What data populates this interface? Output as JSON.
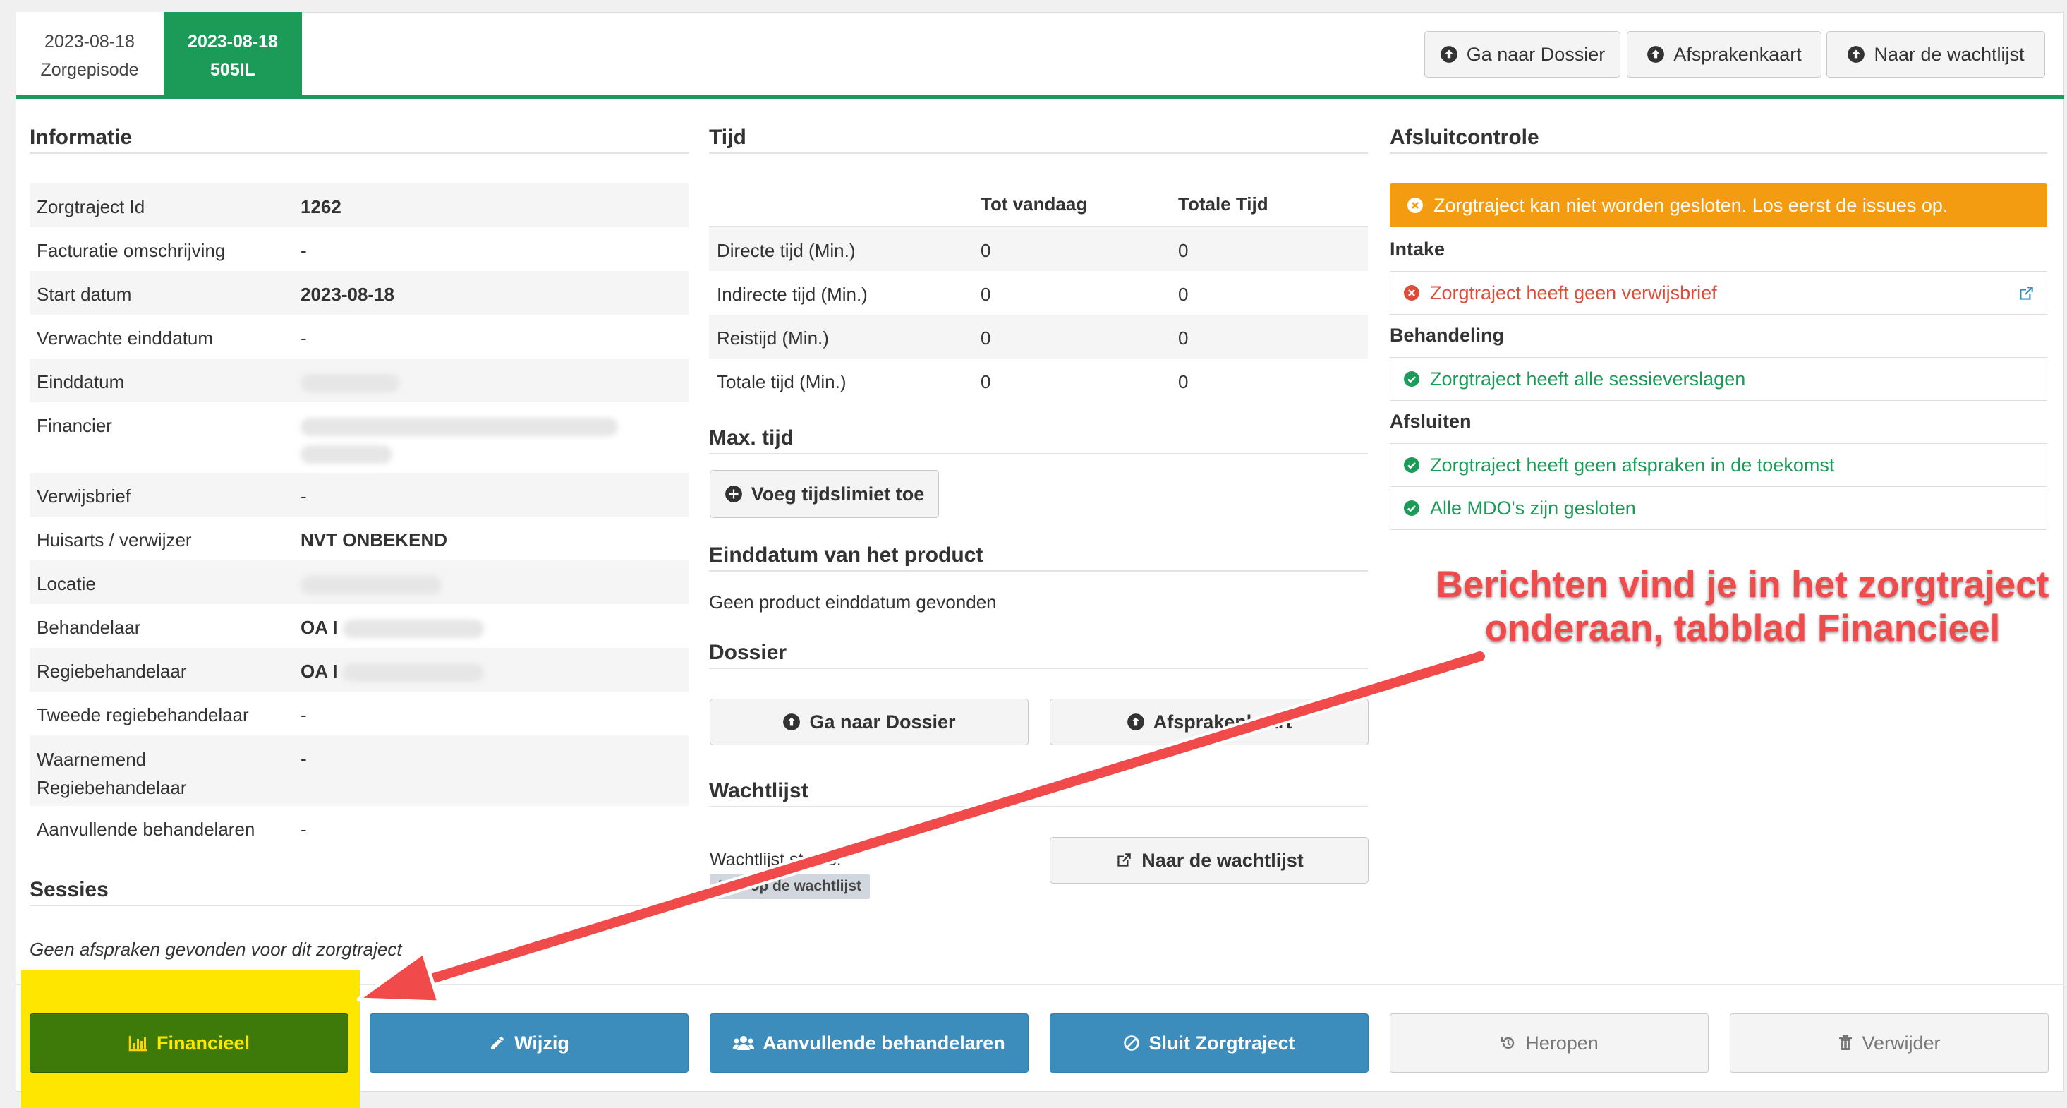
{
  "tabs": [
    {
      "date": "2023-08-18",
      "label": "Zorgepisode"
    },
    {
      "date": "2023-08-18",
      "label": "505IL"
    }
  ],
  "top_buttons": {
    "dossier": "Ga naar Dossier",
    "afsprakenkaart": "Afsprakenkaart",
    "wachtlijst": "Naar de wachtlijst"
  },
  "informatie": {
    "title": "Informatie",
    "rows": [
      {
        "label": "Zorgtraject Id",
        "value": "1262"
      },
      {
        "label": "Facturatie omschrijving",
        "value": "-"
      },
      {
        "label": "Start datum",
        "value": "2023-08-18"
      },
      {
        "label": "Verwachte einddatum",
        "value": "-"
      },
      {
        "label": "Einddatum",
        "value": ""
      },
      {
        "label": "Financier",
        "value": ""
      },
      {
        "label": "Verwijsbrief",
        "value": "-"
      },
      {
        "label": "Huisarts / verwijzer",
        "value": "NVT ONBEKEND"
      },
      {
        "label": "Locatie",
        "value": ""
      },
      {
        "label": "Behandelaar",
        "value": "OA I"
      },
      {
        "label": "Regiebehandelaar",
        "value": "OA I"
      },
      {
        "label": "Tweede regiebehandelaar",
        "value": "-"
      },
      {
        "label": "Waarnemend",
        "label2": "Regiebehandelaar",
        "value": "-"
      },
      {
        "label": "Aanvullende behandelaren",
        "value": "-"
      }
    ]
  },
  "sessies": {
    "title": "Sessies",
    "empty": "Geen afspraken gevonden voor dit zorgtraject"
  },
  "tijd": {
    "title": "Tijd",
    "col_today": "Tot vandaag",
    "col_total": "Totale Tijd",
    "rows": [
      {
        "label": "Directe tijd (Min.)",
        "today": "0",
        "total": "0"
      },
      {
        "label": "Indirecte tijd (Min.)",
        "today": "0",
        "total": "0"
      },
      {
        "label": "Reistijd (Min.)",
        "today": "0",
        "total": "0"
      },
      {
        "label": "Totale tijd (Min.)",
        "today": "0",
        "total": "0"
      }
    ]
  },
  "max_tijd": {
    "title": "Max. tijd",
    "button": "Voeg tijdslimiet toe"
  },
  "einddatum": {
    "title": "Einddatum van het product",
    "text": "Geen product einddatum gevonden"
  },
  "dossier": {
    "title": "Dossier",
    "btn_dossier": "Ga naar Dossier",
    "btn_afspraken": "Afsprakenkaart"
  },
  "wachtlijst": {
    "title": "Wachtlijst",
    "status_label": "Wachtlijst status:",
    "status_badge": "Niet op de wachtlijst",
    "button": "Naar de wachtlijst"
  },
  "afsluitcontrole": {
    "title": "Afsluitcontrole",
    "alert": "Zorgtraject kan niet worden gesloten. Los eerst de issues op.",
    "intake_title": "Intake",
    "intake_item": "Zorgtraject heeft geen verwijsbrief",
    "behandeling_title": "Behandeling",
    "behandeling_item": "Zorgtraject heeft alle sessieverslagen",
    "afsluiten_title": "Afsluiten",
    "afsluiten_items": [
      "Zorgtraject heeft geen afspraken in de toekomst",
      "Alle MDO's zijn gesloten"
    ]
  },
  "annotation": {
    "line1": "Berichten vind je in het zorgtraject",
    "line2": "onderaan, tabblad Financieel"
  },
  "footer_buttons": {
    "financieel": "Financieel",
    "wijzig": "Wijzig",
    "aanvullende": "Aanvullende behandelaren",
    "sluit": "Sluit Zorgtraject",
    "heropen": "Heropen",
    "verwijder": "Verwijder"
  },
  "colors": {
    "green": "#1b9b57",
    "blue": "#3c8dbc",
    "orange": "#f39c12",
    "red": "#dd4b39",
    "highlight": "#ffe600",
    "annotation": "#f04a4a"
  }
}
